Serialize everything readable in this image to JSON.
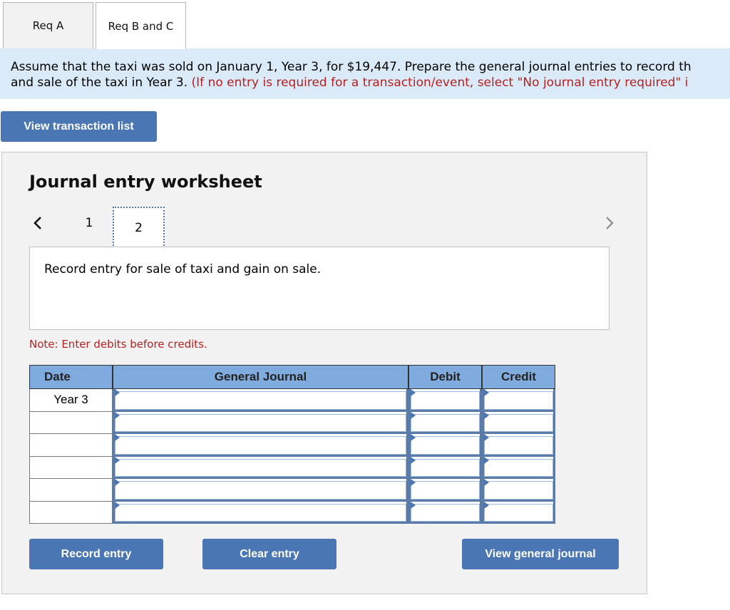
{
  "tabs": [
    {
      "label": "Req A",
      "active": false
    },
    {
      "label": "Req B and C",
      "active": true
    }
  ],
  "instructions": {
    "line1": "Assume that the taxi was sold on January 1, Year 3, for $19,447. Prepare the general journal entries to record th",
    "line2_black": "and sale of the taxi in Year 3. ",
    "line2_red": "(If no entry is required for a transaction/event, select \"No journal entry required\" i"
  },
  "buttons": {
    "view_transaction_list": "View transaction list",
    "record_entry": "Record entry",
    "clear_entry": "Clear entry",
    "view_general_journal": "View general journal"
  },
  "worksheet": {
    "title": "Journal entry worksheet",
    "pages": [
      "1",
      "2"
    ],
    "current_page": "2",
    "description": "Record entry for sale of taxi and gain on sale.",
    "note": "Note: Enter debits before credits."
  },
  "table": {
    "headers": {
      "date": "Date",
      "general_journal": "General Journal",
      "debit": "Debit",
      "credit": "Credit"
    },
    "rows": [
      {
        "date": "Year 3",
        "account": "",
        "debit": "",
        "credit": ""
      },
      {
        "date": "",
        "account": "",
        "debit": "",
        "credit": ""
      },
      {
        "date": "",
        "account": "",
        "debit": "",
        "credit": ""
      },
      {
        "date": "",
        "account": "",
        "debit": "",
        "credit": ""
      },
      {
        "date": "",
        "account": "",
        "debit": "",
        "credit": ""
      },
      {
        "date": "",
        "account": "",
        "debit": "",
        "credit": ""
      }
    ]
  },
  "colors": {
    "accent_button": "#4a76b4",
    "header_fill": "#80abdf",
    "banner_bg": "#dbeaf8",
    "note_red": "#b22222",
    "panel_bg": "#f2f2f2"
  }
}
